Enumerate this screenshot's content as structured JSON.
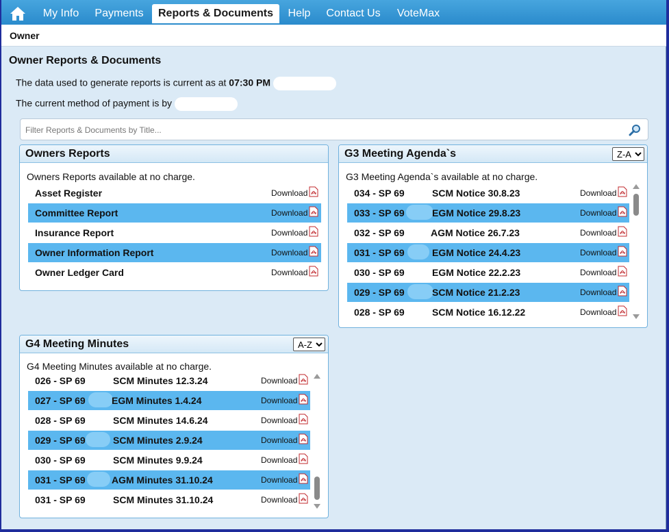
{
  "nav": {
    "tabs": [
      {
        "label": "My Info"
      },
      {
        "label": "Payments"
      },
      {
        "label": "Reports & Documents",
        "active": true
      },
      {
        "label": "Help"
      },
      {
        "label": "Contact Us"
      },
      {
        "label": "VoteMax"
      }
    ]
  },
  "owner_bar": {
    "label": "Owner"
  },
  "page": {
    "title": "Owner Reports & Documents",
    "data_current_text": "The data used to generate reports is current as at ",
    "data_current_time": "07:30 PM",
    "payment_method_text": "The current method of payment is by"
  },
  "filter": {
    "placeholder": "Filter Reports & Documents by Title..."
  },
  "download_label": "Download",
  "owners_reports": {
    "title": "Owners Reports",
    "description": "Owners Reports available at no charge.",
    "items": [
      {
        "title": "Asset Register"
      },
      {
        "title": "Committee Report"
      },
      {
        "title": "Insurance Report"
      },
      {
        "title": "Owner Information Report"
      },
      {
        "title": "Owner Ledger Card"
      }
    ]
  },
  "g3_agendas": {
    "title": "G3 Meeting Agenda`s",
    "description": "G3 Meeting Agenda`s available at no charge.",
    "sort": "Z-A",
    "items": [
      {
        "ref": "034 - SP 69",
        "name": "SCM Notice 30.8.23"
      },
      {
        "ref": "033 - SP 69",
        "name": "EGM Notice 29.8.23"
      },
      {
        "ref": "032 - SP 69",
        "name": "AGM Notice 26.7.23"
      },
      {
        "ref": "031 - SP 69",
        "name": "EGM Notice 24.4.23"
      },
      {
        "ref": "030 - SP 69",
        "name": "EGM Notice 22.2.23"
      },
      {
        "ref": "029 - SP 69",
        "name": "SCM Notice 21.2.23"
      },
      {
        "ref": "028 - SP 69",
        "name": "SCM Notice 16.12.22"
      }
    ]
  },
  "g4_minutes": {
    "title": "G4 Meeting Minutes",
    "description": "G4 Meeting Minutes available at no charge.",
    "sort": "A-Z",
    "items": [
      {
        "ref": "026 - SP 69",
        "name": "SCM Minutes 12.3.24"
      },
      {
        "ref": "027 - SP 69",
        "name": "EGM Minutes 1.4.24"
      },
      {
        "ref": "028 - SP 69",
        "name": "SCM Minutes 14.6.24"
      },
      {
        "ref": "029 - SP 69",
        "name": "SCM Minutes 2.9.24"
      },
      {
        "ref": "030 - SP 69",
        "name": "SCM Minutes 9.9.24"
      },
      {
        "ref": "031 - SP 69",
        "name": "AGM Minutes 31.10.24"
      },
      {
        "ref": "031 - SP 69",
        "name": "SCM Minutes 31.10.24"
      }
    ]
  }
}
